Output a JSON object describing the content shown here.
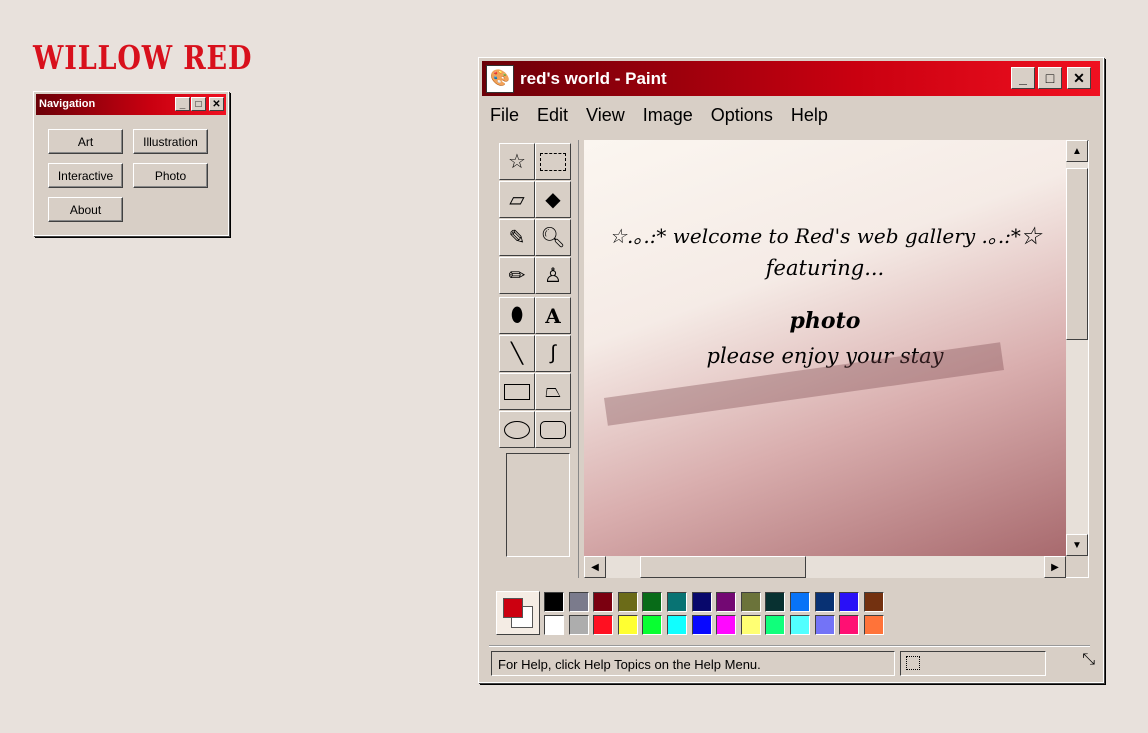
{
  "logo": "WILLOW RED",
  "nav": {
    "title": "Navigation",
    "buttons": [
      "Art",
      "Illustration",
      "Interactive",
      "Photo",
      "About"
    ]
  },
  "paint": {
    "title": "red's world - Paint",
    "menu": [
      "File",
      "Edit",
      "View",
      "Image",
      "Options",
      "Help"
    ],
    "tools": [
      "free-select",
      "rect-select",
      "eraser",
      "fill",
      "color-picker",
      "magnifier",
      "pencil",
      "brush",
      "airbrush",
      "text",
      "line",
      "curve",
      "rectangle",
      "polygon",
      "ellipse",
      "rounded-rectangle"
    ],
    "canvas": {
      "line1": "☆.｡.:* welcome to Red's web gallery .｡.:*☆",
      "line2": "featuring...",
      "line3": "photo",
      "line4": "please enjoy your stay"
    },
    "palette_top": [
      "#000000",
      "#7b7b8c",
      "#7b0010",
      "#6b6b18",
      "#086b18",
      "#087373",
      "#08086b",
      "#730873",
      "#6b733a",
      "#083131",
      "#0873f7",
      "#083173",
      "#2910f7",
      "#733110"
    ],
    "palette_bottom": [
      "#ffffff",
      "#adadad",
      "#ff1021",
      "#ffff31",
      "#08ff31",
      "#10ffff",
      "#0808ff",
      "#ff08ff",
      "#ffff73",
      "#10ff7b",
      "#52ffff",
      "#7373f7",
      "#ff1073",
      "#ff7339"
    ],
    "foreground": "#cc0010",
    "background": "#ffffff",
    "status": "For Help, click Help Topics on the Help Menu."
  }
}
